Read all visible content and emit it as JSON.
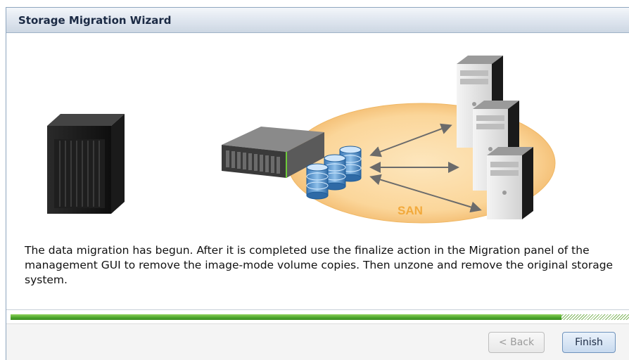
{
  "dialog": {
    "title": "Storage Migration Wizard"
  },
  "illustration": {
    "san_label": "SAN"
  },
  "message": {
    "text": "The data migration has begun. After it is completed use the finalize action in the Migration panel of the management GUI to remove the image-mode volume copies. Then unzone and remove the original storage system."
  },
  "progress": {
    "fraction_complete": 0.89
  },
  "buttons": {
    "back_label": "< Back",
    "back_enabled": false,
    "finish_label": "Finish"
  },
  "colors": {
    "title_text": "#1b2a44",
    "progress_green": "#4aa32a",
    "san_ellipse": "#fbd9a0",
    "san_label": "#f2a93b"
  }
}
